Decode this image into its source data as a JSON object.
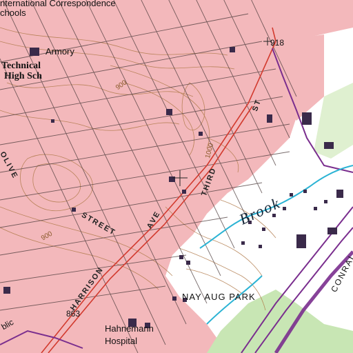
{
  "map": {
    "labels": {
      "correspondence": "nternational Correspondence",
      "schools": "chools",
      "armory": "Armory",
      "technical_1": "Technical",
      "technical_2": "High Sch",
      "olive": "OLIVE",
      "street": "STREET",
      "harrison": "HARRISON",
      "ave": "AVE",
      "third": "THIRD",
      "st": "ST",
      "brook": "Brook",
      "nay_aug_park": "NAY AUG PARK",
      "conrail": "CONRAI",
      "hahnemann_1": "Hahnemann",
      "hahnemann_2": "Hospital",
      "bm_918": "918",
      "bm_863": "863",
      "contour_900a": "900",
      "contour_900b": "900",
      "contour_1000": "1000",
      "public": "blic"
    },
    "colors": {
      "urban_tint": "#f3b8bb",
      "open_land": "#ffffff",
      "woodland": "#c8e6b4",
      "contours": "#b07a4a",
      "streets": "#4a3a3a",
      "railroad": "#7a2e8e",
      "water": "#2bb3d4",
      "major_road": "#d23a2e"
    }
  }
}
